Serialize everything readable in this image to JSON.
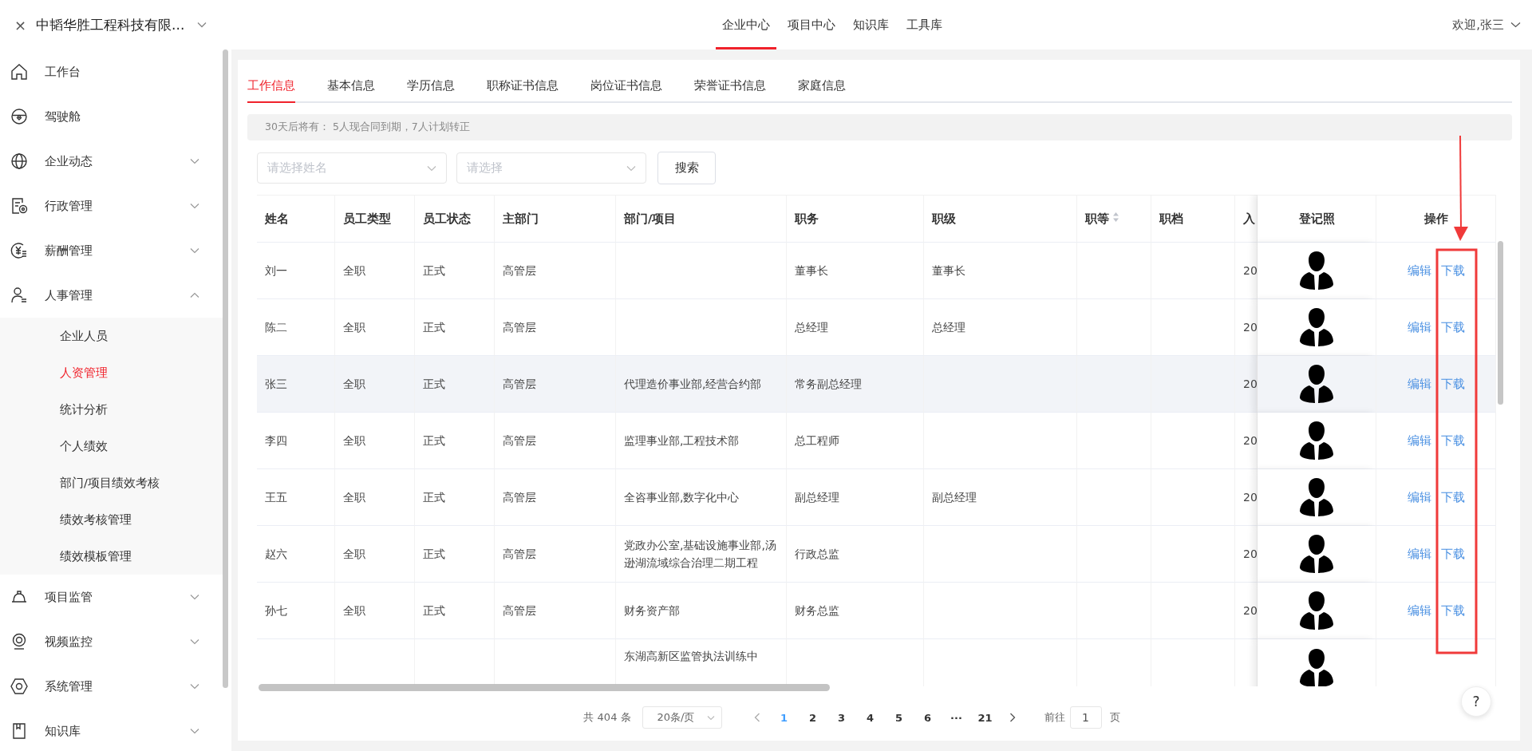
{
  "header": {
    "close_glyph": "×",
    "company": "中韬华胜工程科技有限...",
    "expanded": false,
    "top_nav": [
      {
        "label": "企业中心",
        "selected": true
      },
      {
        "label": "项目中心",
        "selected": false
      },
      {
        "label": "知识库",
        "selected": false
      },
      {
        "label": "工具库",
        "selected": false
      }
    ],
    "user": "欢迎,张三"
  },
  "sidebar": {
    "items": [
      {
        "label": "工作台"
      },
      {
        "label": "驾驶舱"
      },
      {
        "label": "企业动态",
        "expanded": false
      },
      {
        "label": "行政管理",
        "expanded": false
      },
      {
        "label": "薪酬管理",
        "expanded": false
      },
      {
        "label": "人事管理",
        "expanded": true,
        "children": [
          {
            "label": "企业人员",
            "selected": false
          },
          {
            "label": "人资管理",
            "selected": true
          },
          {
            "label": "统计分析",
            "selected": false
          },
          {
            "label": "个人绩效",
            "selected": false
          },
          {
            "label": "部门/项目绩效考核",
            "selected": false
          },
          {
            "label": "绩效考核管理",
            "selected": false
          },
          {
            "label": "绩效模板管理",
            "selected": false
          }
        ]
      },
      {
        "label": "项目监管",
        "expanded": false
      },
      {
        "label": "视频监控",
        "expanded": false
      },
      {
        "label": "系统管理",
        "expanded": false
      },
      {
        "label": "知识库",
        "expanded": false
      }
    ]
  },
  "tabs": [
    {
      "label": "工作信息",
      "selected": true
    },
    {
      "label": "基本信息",
      "selected": false
    },
    {
      "label": "学历信息",
      "selected": false
    },
    {
      "label": "职称证书信息",
      "selected": false
    },
    {
      "label": "岗位证书信息",
      "selected": false
    },
    {
      "label": "荣誉证书信息",
      "selected": false
    },
    {
      "label": "家庭信息",
      "selected": false
    }
  ],
  "notice": "30天后将有： 5人现合同到期，7人计划转正",
  "filters": [
    {
      "placeholder": "请选择姓名"
    },
    {
      "placeholder": "请选择"
    }
  ],
  "search_button": "搜索",
  "table": {
    "columns": [
      {
        "label": "姓名"
      },
      {
        "label": "员工类型"
      },
      {
        "label": "员工状态"
      },
      {
        "label": "主部门"
      },
      {
        "label": "部门/项目"
      },
      {
        "label": "职务"
      },
      {
        "label": "职级"
      },
      {
        "label": "职等",
        "sortable": true
      },
      {
        "label": "职档"
      },
      {
        "label": "入"
      }
    ],
    "fixed_columns": [
      "登记照",
      "操作"
    ],
    "rows": [
      {
        "highlighted": false,
        "cells": [
          "刘一",
          "全职",
          "正式",
          "高管层",
          null,
          "董事长",
          "董事长",
          null,
          null,
          "20"
        ],
        "actions": [
          "编辑",
          "下载"
        ]
      },
      {
        "highlighted": false,
        "cells": [
          "陈二",
          "全职",
          "正式",
          "高管层",
          null,
          "总经理",
          "总经理",
          null,
          null,
          "20"
        ],
        "actions": [
          "编辑",
          "下载"
        ]
      },
      {
        "highlighted": true,
        "cells": [
          "张三",
          "全职",
          "正式",
          "高管层",
          "代理造价事业部,经营合约部",
          "常务副总经理",
          null,
          null,
          null,
          "20"
        ],
        "actions": [
          "编辑",
          "下载"
        ]
      },
      {
        "highlighted": false,
        "cells": [
          "李四",
          "全职",
          "正式",
          "高管层",
          "监理事业部,工程技术部",
          "总工程师",
          null,
          null,
          null,
          "20"
        ],
        "actions": [
          "编辑",
          "下载"
        ]
      },
      {
        "highlighted": false,
        "cells": [
          "王五",
          "全职",
          "正式",
          "高管层",
          "全咨事业部,数字化中心",
          "副总经理",
          "副总经理",
          null,
          null,
          "20"
        ],
        "actions": [
          "编辑",
          "下载"
        ]
      },
      {
        "highlighted": false,
        "cells": [
          "赵六",
          "全职",
          "正式",
          "高管层",
          "党政办公室,基础设施事业部,汤逊湖流域综合治理二期工程",
          "行政总监",
          null,
          null,
          null,
          "20"
        ],
        "actions": [
          "编辑",
          "下载"
        ]
      },
      {
        "highlighted": false,
        "cells": [
          "孙七",
          "全职",
          "正式",
          "高管层",
          "财务资产部",
          "财务总监",
          null,
          null,
          null,
          "20"
        ],
        "actions": [
          "编辑",
          "下载"
        ]
      },
      {
        "highlighted": false,
        "cells": [
          null,
          null,
          null,
          null,
          "东湖高新区监管执法训练中",
          null,
          null,
          null,
          null,
          null
        ]
      }
    ]
  },
  "pagination": {
    "total": "共 404 条",
    "page_size": "20条/页",
    "pages": [
      {
        "label": "1",
        "selected": true
      },
      {
        "label": "2",
        "selected": false
      },
      {
        "label": "3",
        "selected": false
      },
      {
        "label": "4",
        "selected": false
      },
      {
        "label": "5",
        "selected": false
      },
      {
        "label": "6",
        "selected": false
      },
      {
        "label": "···",
        "selected": false
      },
      {
        "label": "21",
        "selected": false
      }
    ],
    "goto_label": "前往",
    "goto_value": "1",
    "goto_unit": "页"
  },
  "help": "?"
}
